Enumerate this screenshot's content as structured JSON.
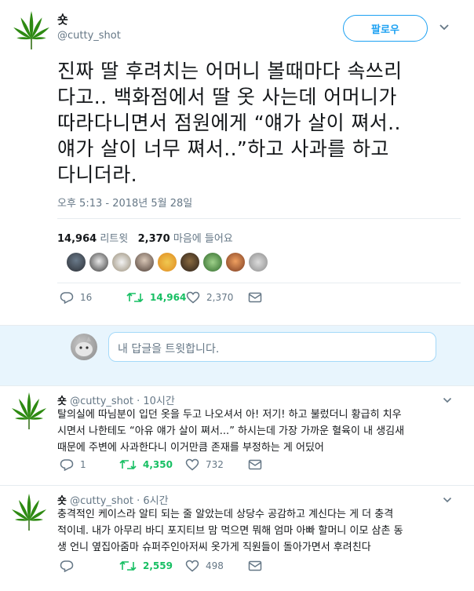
{
  "tweet": {
    "name": "숏",
    "handle": "@cutty_shot",
    "follow_label": "팔로우",
    "text_lines": [
      "진짜 딸 후려치는 어머니 볼때마다 속쓰리",
      "다고.. 백화점에서 딸 옷 사는데 어머니가",
      "따라다니면서 점원에게 “얘가 살이 쪄서..",
      "얘가 살이 너무 쪄서..”하고 사과를 하고",
      "다니더라."
    ],
    "timestamp": "오후 5:13 - 2018년 5월 28일",
    "retweets_count": "14,964",
    "retweets_label": "리트윗",
    "likes_count": "2,370",
    "likes_label": "마음에 들어요",
    "actions": {
      "reply": "16",
      "retweet": "14,964",
      "like": "2,370"
    }
  },
  "reply_box": {
    "placeholder": "내 답글을 트윗합니다."
  },
  "replies": [
    {
      "name": "숏",
      "handle": "@cutty_shot",
      "time": "· 10시간",
      "text_lines": [
        "탈의실에 따님분이 입던 옷을 두고 나오셔서 아! 저기! 하고 불렀더니 황급히 치우",
        "시면서 나한테도 “아유 얘가 살이 쪄서...” 하시는데 가장 가까운 혈육이 내 생김새",
        "때문에 주변에 사과한다니 이거만큼 존재를 부정하는 게 어딨어"
      ],
      "actions": {
        "reply": "1",
        "retweet": "4,350",
        "like": "732"
      }
    },
    {
      "name": "숏",
      "handle": "@cutty_shot",
      "time": "· 6시간",
      "text_lines": [
        "충격적인 케이스라 알티 되는 줄 알았는데 상당수 공감하고 계신다는 게 더 충격",
        "적이네. 내가 아무리 바디 포지티브 맘 먹으면 뭐해 엄마 아빠 할머니 이모 삼촌 동",
        "생 언니 옆집아줌마 슈퍼주인아저씨 옷가게 직원들이 돌아가면서 후려친다"
      ],
      "actions": {
        "reply": "",
        "retweet": "2,559",
        "like": "498"
      }
    }
  ],
  "colors": {
    "accent": "#1da1f2",
    "retweet": "#17bf63",
    "muted": "#657786",
    "leaf": "#2e7d12"
  },
  "icons": [
    "cannabis-leaf-avatar",
    "chevron-down-icon",
    "reply-icon",
    "retweet-icon",
    "heart-icon",
    "message-icon"
  ]
}
